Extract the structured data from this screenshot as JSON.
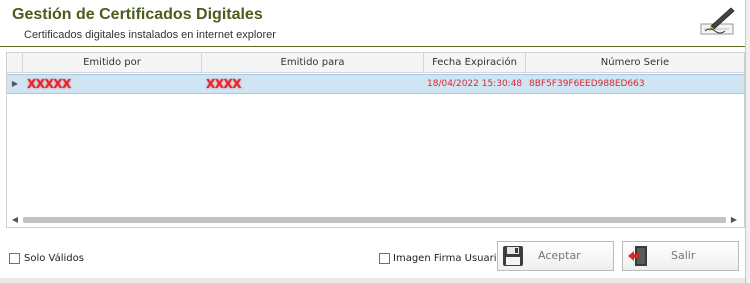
{
  "header": {
    "title": "Gestión de Certificados Digitales",
    "subtitle": "Certificados digitales instalados en internet explorer",
    "icon": "certificate-pen-icon"
  },
  "grid": {
    "columns": [
      "Emitido por",
      "Emitido para",
      "Fecha Expiración",
      "Número Serie"
    ],
    "rows": [
      {
        "emitido_por": "XXXXX",
        "emitido_para": "XXXX",
        "fecha_expiracion": "18/04/2022 15:30:48",
        "numero_serie": "8BF5F39F6EED988ED663"
      }
    ],
    "row_indicator_icon": "row-selector-arrow-icon",
    "scroll_left_icon": "scroll-left-arrow-icon",
    "scroll_right_icon": "scroll-right-arrow-icon"
  },
  "footer": {
    "solo_validos_label": "Solo Válidos",
    "solo_validos_checked": false,
    "imagen_firma_label": "Imagen Firma Usuario",
    "imagen_firma_checked": false,
    "accept_label": "Aceptar",
    "accept_icon": "floppy-disk-icon",
    "exit_label": "Salir",
    "exit_icon": "exit-door-icon"
  },
  "colors": {
    "title": "#4a5d1d",
    "selected_row": "#cfe5f4",
    "row_text": "#e0262e"
  }
}
